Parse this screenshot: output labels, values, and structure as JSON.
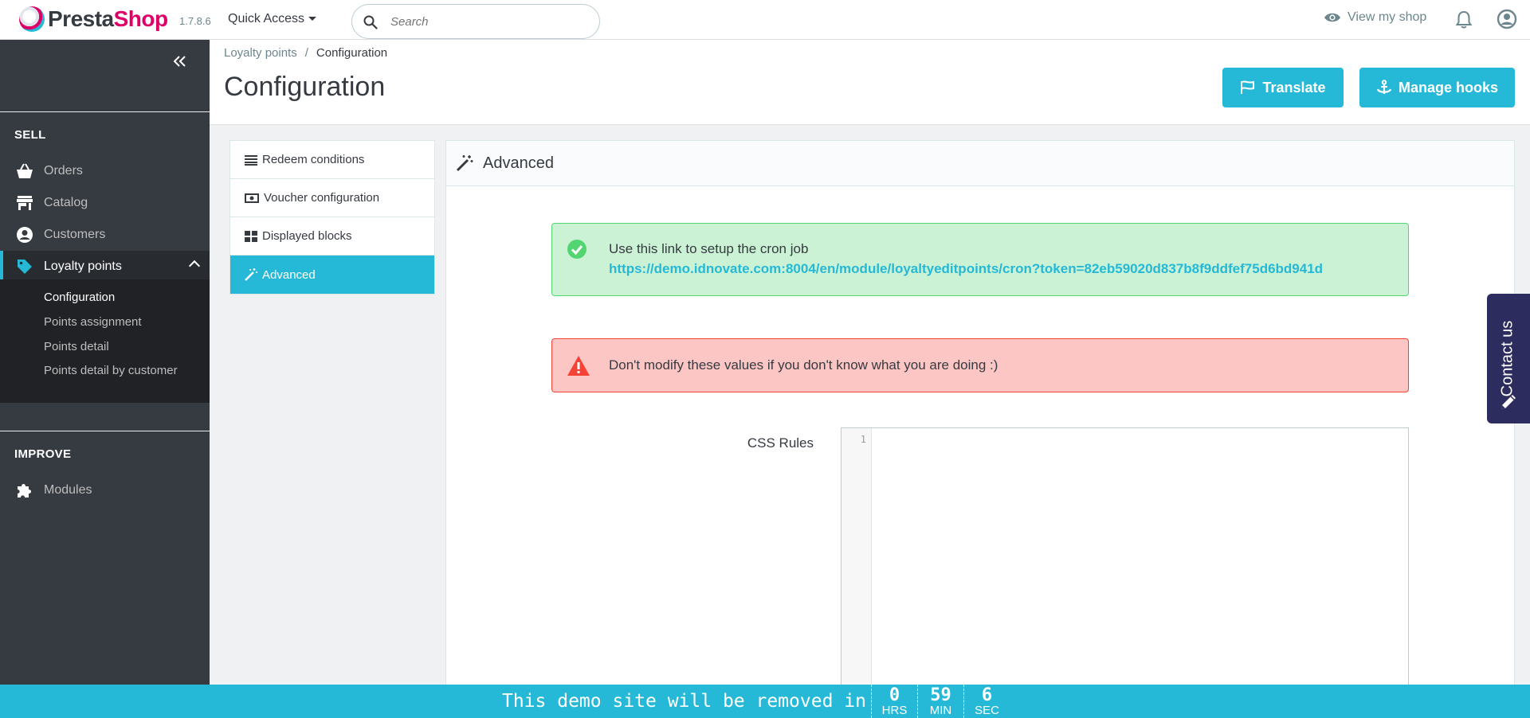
{
  "header": {
    "brand_part1": "Presta",
    "brand_part2": "Shop",
    "version": "1.7.8.6",
    "quick_access": "Quick Access",
    "search_placeholder": "Search",
    "view_shop": "View my shop"
  },
  "sidebar": {
    "sell_title": "SELL",
    "improve_title": "IMPROVE",
    "items": [
      {
        "label": "Orders",
        "icon": "basket-icon"
      },
      {
        "label": "Catalog",
        "icon": "store-icon"
      },
      {
        "label": "Customers",
        "icon": "account-circle-icon"
      },
      {
        "label": "Loyalty points",
        "icon": "tag-icon"
      },
      {
        "label": "Modules",
        "icon": "puzzle-icon"
      }
    ],
    "submenu": [
      "Configuration",
      "Points assignment",
      "Points detail",
      "Points detail by customer"
    ]
  },
  "breadcrumb": {
    "parent": "Loyalty points",
    "separator": "/",
    "current": "Configuration"
  },
  "page": {
    "title": "Configuration",
    "translate_button": "Translate",
    "manage_hooks_button": "Manage hooks"
  },
  "tabs": [
    {
      "label": "Redeem conditions",
      "icon": "list-icon"
    },
    {
      "label": "Voucher configuration",
      "icon": "money-icon"
    },
    {
      "label": "Displayed blocks",
      "icon": "grid-icon"
    },
    {
      "label": "Advanced",
      "icon": "magic-wand-icon"
    }
  ],
  "panel": {
    "title": "Advanced",
    "success_message": "Use this link to setup the cron job",
    "cron_url": "https://demo.idnovate.com:8004/en/module/loyaltyeditpoints/cron?token=82eb59020d837b8f9ddfef75d6bd941d",
    "danger_message": "Don't modify these values if you don't know what you are doing :)",
    "css_label": "CSS Rules",
    "editor_line": "1"
  },
  "contact": {
    "label": "Contact us"
  },
  "demo_bar": {
    "text": "This demo site will be removed in",
    "hours": "0",
    "hours_unit": "HRS",
    "minutes": "59",
    "minutes_unit": "MIN",
    "seconds": "6",
    "seconds_unit": "SEC"
  },
  "colors": {
    "accent": "#25b9d7",
    "sidebar": "#363a41",
    "brand_pink": "#df0067",
    "success_bg": "#cbf2d4",
    "danger_bg": "#fbc6c3"
  }
}
